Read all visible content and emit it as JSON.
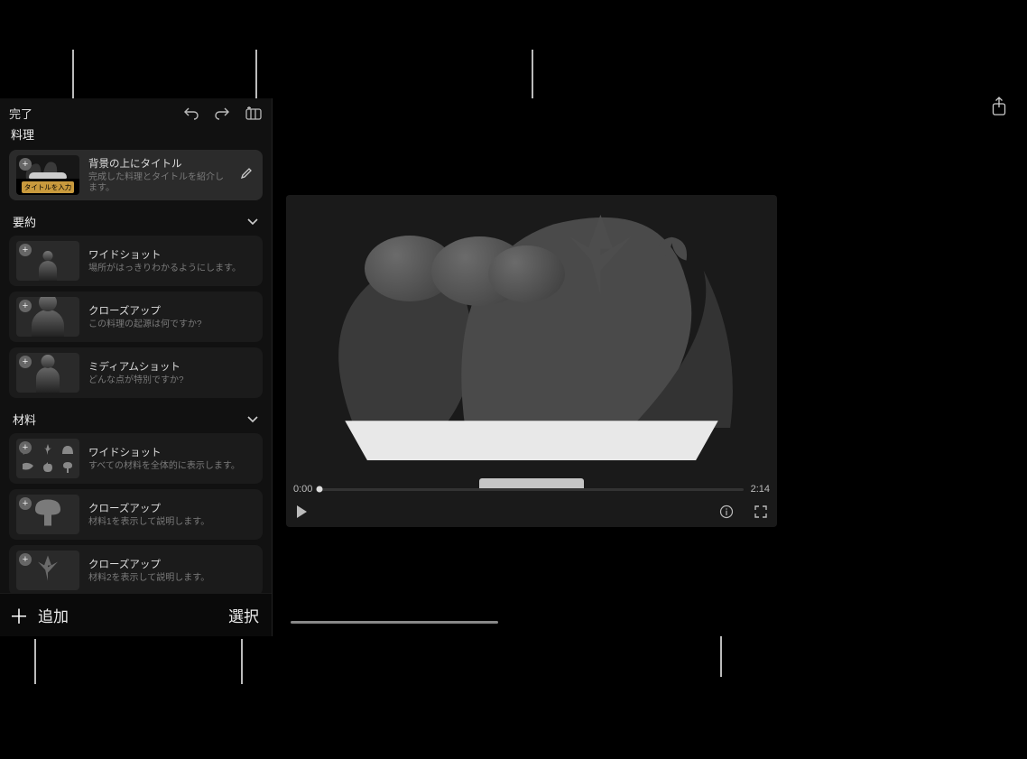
{
  "toolbar": {
    "done": "完了",
    "project_title": "料理",
    "share_label": "share"
  },
  "title_card": {
    "badge": "タイトルを入力",
    "title": "背景の上にタイトル",
    "subtitle": "完成した料理とタイトルを紹介します。"
  },
  "sections": {
    "summary": {
      "label": "要約",
      "shots": [
        {
          "title": "ワイドショット",
          "subtitle": "場所がはっきりわかるようにします。"
        },
        {
          "title": "クローズアップ",
          "subtitle": "この料理の起源は何ですか?"
        },
        {
          "title": "ミディアムショット",
          "subtitle": "どんな点が特別ですか?"
        }
      ]
    },
    "ingredients": {
      "label": "材料",
      "shots": [
        {
          "title": "ワイドショット",
          "subtitle": "すべての材料を全体的に表示します。"
        },
        {
          "title": "クローズアップ",
          "subtitle": "材料1を表示して説明します。"
        },
        {
          "title": "クローズアップ",
          "subtitle": "材料2を表示して説明します。"
        }
      ]
    }
  },
  "bottom_bar": {
    "add": "追加",
    "select": "選択"
  },
  "player": {
    "current": "0:00",
    "total": "2:14"
  }
}
